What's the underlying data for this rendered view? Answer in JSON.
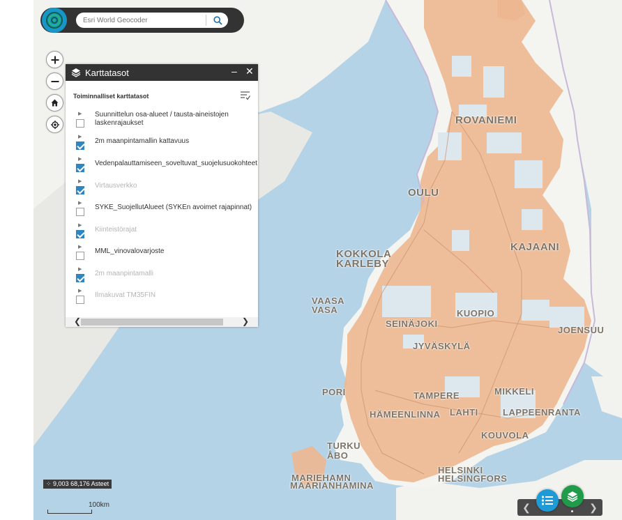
{
  "search": {
    "placeholder": "Esri World Geocoder"
  },
  "panel": {
    "title": "Karttatasot",
    "minimize_label": "–",
    "close_label": "✕",
    "subtitle": "Toiminnalliset karttatasot",
    "layers": [
      {
        "label": "Suunnittelun osa-alueet / tausta-aineistojen laskenrajaukset",
        "checked": false
      },
      {
        "label": "2m maanpintamallin kattavuus",
        "checked": true
      },
      {
        "label": "Vedenpalauttamiseen_soveltuvat_suojelusuokohteet",
        "checked": true
      },
      {
        "label": "Virtausverkko",
        "checked": true
      },
      {
        "label": "SYKE_SuojellutAlueet (SYKEn avoimet rajapinnat)",
        "checked": false
      },
      {
        "label": "Kiinteistörajat",
        "checked": true
      },
      {
        "label": "MML_vinovalovarjoste",
        "checked": false
      },
      {
        "label": "2m maanpintamalli",
        "checked": true
      },
      {
        "label": "Ilmakuvat TM35FIN",
        "checked": false
      }
    ]
  },
  "status": {
    "coordinates": "9,003 68,176 Asteet",
    "scale": "100km"
  },
  "cities": {
    "rovaniemi": "ROVANIEMI",
    "oulu": "OULU",
    "kokkola": "KOKKOLA",
    "karleby": "KARLEBY",
    "kajaani": "KAJAANI",
    "vaasa1": "VAASA",
    "vaasa2": "VASA",
    "seinajoki": "SEINÄJOKI",
    "kuopio": "KUOPIO",
    "joensuu": "JOENSUU",
    "jyvaskyla": "JYVÄSKYLÄ",
    "pori": "PORI",
    "tampere": "TAMPERE",
    "mikkeli": "MIKKELI",
    "hameenlinna": "HÄMEENLINNA",
    "lahti": "LAHTI",
    "lappeenranta": "LAPPEENRANTA",
    "kouvola": "KOUVOLA",
    "turku": "TURKU",
    "abo": "ÅBO",
    "helsinki": "HELSINKI",
    "helsingfors": "HELSINGFORS",
    "mariehamn": "MARIEHAMN",
    "maarianhamina": "MAARIANHAMINA"
  },
  "colors": {
    "sea": "#b5d3e7",
    "land": "#f2f2ee",
    "coverage": "#edb792",
    "accent": "#2f84c2",
    "toolbar": "#333333"
  },
  "icons": [
    "app-logo-icon",
    "search-icon",
    "zoom-in-icon",
    "zoom-out-icon",
    "home-icon",
    "locate-icon",
    "layers-icon",
    "layer-options-icon",
    "legend-icon"
  ]
}
